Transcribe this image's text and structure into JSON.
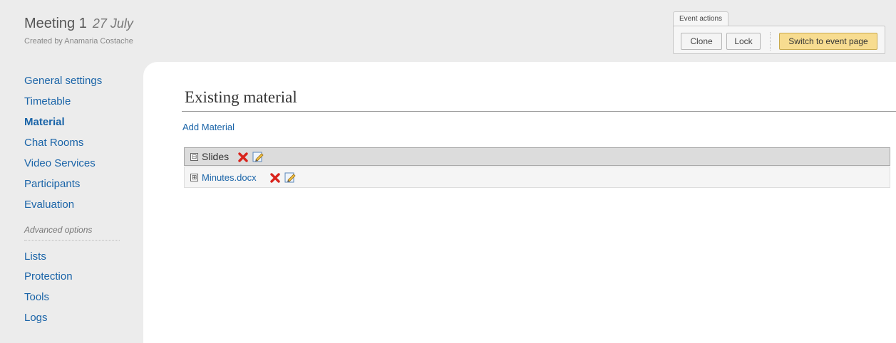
{
  "header": {
    "event_title": "Meeting 1",
    "event_date": "27 July",
    "created_by": "Created by Anamaria Costache"
  },
  "event_actions": {
    "tab_label": "Event actions",
    "clone_label": "Clone",
    "lock_label": "Lock",
    "switch_label": "Switch to event page"
  },
  "sidebar": {
    "items": [
      {
        "label": "General settings"
      },
      {
        "label": "Timetable"
      },
      {
        "label": "Material",
        "active": true
      },
      {
        "label": "Chat Rooms"
      },
      {
        "label": "Video Services"
      },
      {
        "label": "Participants"
      },
      {
        "label": "Evaluation"
      }
    ],
    "advanced_label": "Advanced options",
    "advanced_items": [
      {
        "label": "Lists"
      },
      {
        "label": "Protection"
      },
      {
        "label": "Tools"
      },
      {
        "label": "Logs"
      }
    ]
  },
  "main": {
    "title": "Existing material",
    "add_link": "Add Material",
    "tree": {
      "folder": {
        "label": "Slides",
        "toggle": "⊟",
        "expanded": true
      },
      "file": {
        "label": "Minutes.docx",
        "toggle": "⊞",
        "expanded": false
      }
    }
  },
  "colors": {
    "link": "#1a64a8",
    "switch_button": "#f7dc90",
    "delete_icon": "#d9231c"
  },
  "icons": {
    "delete": "delete-x-icon",
    "edit": "edit-pencil-icon"
  }
}
